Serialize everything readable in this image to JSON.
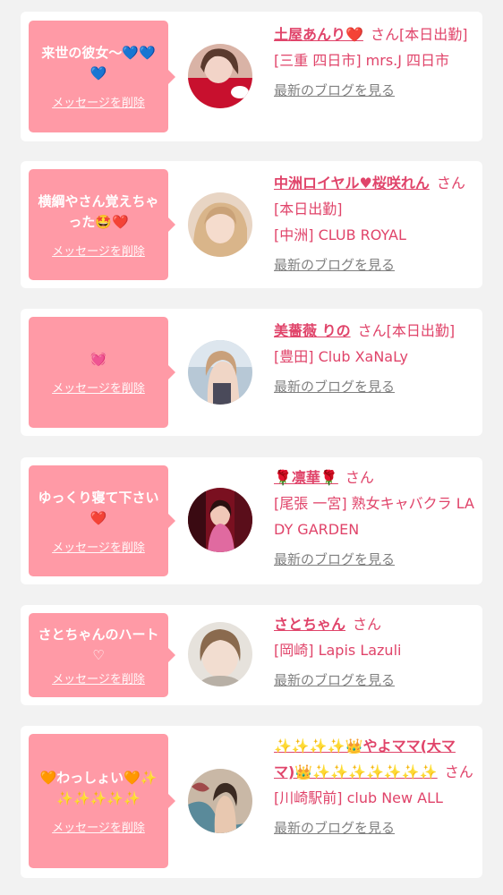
{
  "list": [
    {
      "message": "来世の彼女〜💙💙💙",
      "delete_label": "メッセージを削除",
      "name": "土屋あんり❤️",
      "san": "さん",
      "status": "[本日出勤]",
      "shop": "[三重 四日市] mrs.J 四日市",
      "blog_label": "最新のブログを見る"
    },
    {
      "message": "横綱やさん覚えちゃった🤩❤️",
      "delete_label": "メッセージを削除",
      "name": "中洲ロイヤル♥桜咲れん",
      "san": "さん",
      "status": "[本日出勤]",
      "shop": "[中洲] CLUB ROYAL",
      "blog_label": "最新のブログを見る"
    },
    {
      "message": "💓",
      "delete_label": "メッセージを削除",
      "name": "美薔薇 りの",
      "san": "さん",
      "status": "[本日出勤]",
      "shop": "[豊田] Club XaNaLy",
      "blog_label": "最新のブログを見る"
    },
    {
      "message": "ゆっくり寝て下さい❤️",
      "delete_label": "メッセージを削除",
      "name": "🌹凛華🌹",
      "san": "さん",
      "status": "",
      "shop": "[尾張 一宮] 熟女キャバクラ LADY GARDEN",
      "blog_label": "最新のブログを見る"
    },
    {
      "message": "さとちゃんのハート♡",
      "delete_label": "メッセージを削除",
      "name": "さとちゃん",
      "san": "さん",
      "status": "",
      "shop": "[岡崎] Lapis Lazuli",
      "blog_label": "最新のブログを見る"
    },
    {
      "message": "🧡わっしょい🧡✨✨✨✨✨✨",
      "delete_label": "メッセージを削除",
      "name": "✨✨✨✨👑やよママ(大ママ)👑✨✨✨✨✨✨✨",
      "san": "さん",
      "status": "",
      "shop": "[川崎駅前] club New ALL",
      "blog_label": "最新のブログを見る"
    }
  ],
  "colors": {
    "bubble": "#ff9aa6",
    "accent": "#e0446a",
    "link_gray": "#808080",
    "page_bg": "#f2f2f2"
  }
}
